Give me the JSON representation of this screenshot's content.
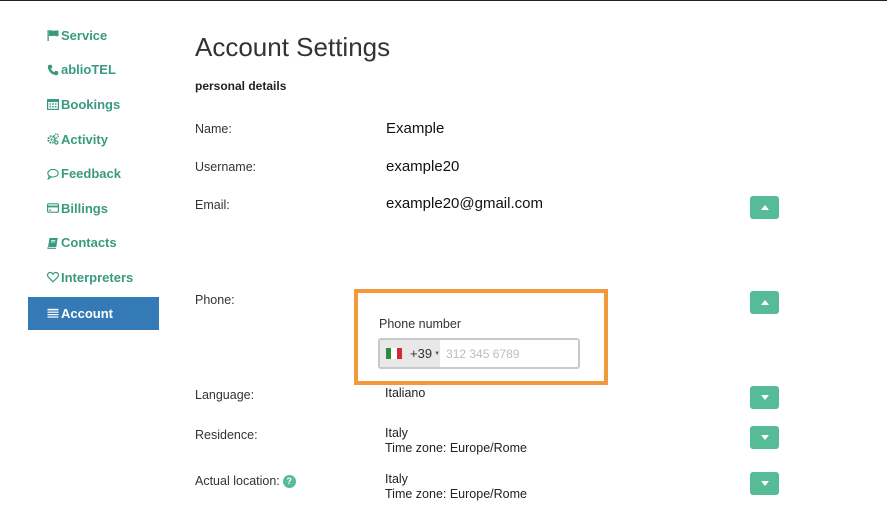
{
  "sidebar": {
    "items": [
      {
        "label": "Service",
        "icon": "flag-icon"
      },
      {
        "label": "ablioTEL",
        "icon": "phone-icon"
      },
      {
        "label": "Bookings",
        "icon": "calendar-icon"
      },
      {
        "label": "Activity",
        "icon": "gears-icon"
      },
      {
        "label": "Feedback",
        "icon": "comment-icon"
      },
      {
        "label": "Billings",
        "icon": "credit-card-icon"
      },
      {
        "label": "Contacts",
        "icon": "book-icon"
      },
      {
        "label": "Interpreters",
        "icon": "heart-icon"
      },
      {
        "label": "Account",
        "icon": "list-icon",
        "active": true
      }
    ]
  },
  "page": {
    "title": "Account Settings",
    "subtitle": "personal details"
  },
  "fields": {
    "name": {
      "label": "Name:",
      "value": "Example"
    },
    "username": {
      "label": "Username:",
      "value": "example20"
    },
    "email": {
      "label": "Email:",
      "value": "example20@gmail.com"
    },
    "phone": {
      "label": "Phone:",
      "caption": "Phone number",
      "dial_code": "+39",
      "country_flag": "italy-flag",
      "placeholder": "312 345 6789",
      "value": ""
    },
    "language": {
      "label": "Language:",
      "value": "Italiano"
    },
    "residence": {
      "label": "Residence:",
      "country": "Italy",
      "timezone": "Time zone: Europe/Rome"
    },
    "actual_location": {
      "label": "Actual location:",
      "country": "Italy",
      "timezone": "Time zone: Europe/Rome"
    }
  },
  "colors": {
    "accent_green": "#56bb97",
    "sidebar_text": "#3a9a80",
    "active_nav": "#337ab7",
    "highlight_border": "#f29a3a"
  }
}
